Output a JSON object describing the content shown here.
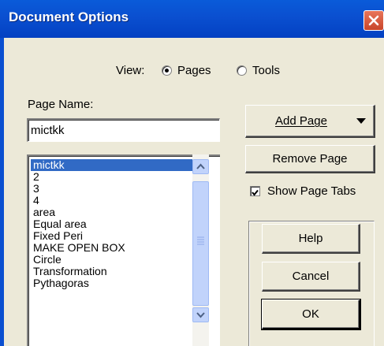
{
  "window": {
    "title": "Document Options"
  },
  "view": {
    "label": "View:",
    "options": [
      "Pages",
      "Tools"
    ],
    "selected": "Pages"
  },
  "page_name": {
    "label": "Page Name:",
    "value": "mictkk"
  },
  "pages": [
    "mictkk",
    "2",
    "3",
    "4",
    "area",
    "Equal area",
    "Fixed Peri",
    "MAKE OPEN BOX",
    "Circle",
    "Transformation",
    "Pythagoras"
  ],
  "selected_page": "mictkk",
  "buttons": {
    "add_page": "Add Page",
    "remove_page": "Remove Page",
    "help": "Help",
    "cancel": "Cancel",
    "ok": "OK"
  },
  "show_page_tabs": {
    "label": "Show Page Tabs",
    "checked": true
  },
  "colors": {
    "title_bar": "#0a4fd0",
    "selection": "#316ac5",
    "close_button": "#d6543a",
    "dialog_bg": "#ece9d8"
  },
  "icons": {
    "close": "close-icon",
    "dropdown": "triangle-down-icon",
    "scroll_up": "chevron-up-icon",
    "scroll_down": "chevron-down-icon"
  }
}
